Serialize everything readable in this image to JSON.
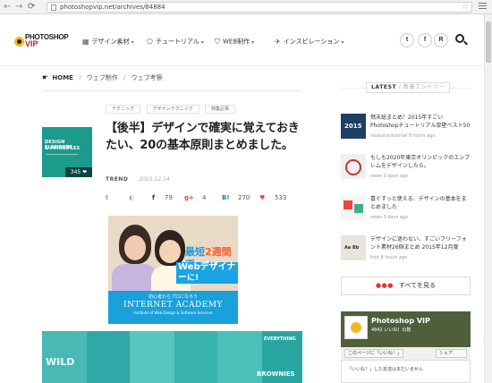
{
  "browser": {
    "back": "←",
    "forward": "→",
    "reload": "⟳",
    "url": "photoshopvip.net/archives/84884",
    "star": "☆"
  },
  "header": {
    "logo_line1": "PHOTOSHOP",
    "logo_line2": "VIP",
    "nav": [
      {
        "label": "デザイン素材",
        "icon": "grid-icon"
      },
      {
        "label": "チュートリアル",
        "icon": "pentagon-icon"
      },
      {
        "label": "WEB制作",
        "icon": "html5-icon"
      },
      {
        "label": "インスピレーション",
        "icon": "rocket-icon"
      }
    ],
    "social": {
      "twitter": "t",
      "facebook": "f",
      "rss": "R",
      "feedly": "◐"
    }
  },
  "breadcrumb": {
    "hand": "☛",
    "home": "HOME",
    "items": [
      "ウェブ制作",
      "ウェブ考察"
    ],
    "separator": "/"
  },
  "article": {
    "tags": [
      "テクニック",
      "デザインテクニック",
      "特集記事"
    ],
    "title": "【後半】デザインで確実に覚えておきたい、20の基本原則まとめました。",
    "thumb_line1": "DESIGN ELEMENTS",
    "thumb_line2": "& PRINCIPLES",
    "thumb_count": "345 ❤",
    "category": "TREND",
    "date": "2015.12.14",
    "share": {
      "twitter_count": "",
      "hatena_count": "",
      "facebook_count": "79",
      "gplus_count": "4",
      "hatena_b_count": "270",
      "pocket_count": "533"
    }
  },
  "ad": {
    "headline_prefix": "最短",
    "headline_highlight": "2週間",
    "headline_suffix": "で",
    "subline": "Webデザイナー",
    "subline_suffix": "に!",
    "line1": "初心者からプロになろう",
    "brand": "INTERNET ACADEMY",
    "brand_sub": "Institute of Web Design & Software Services"
  },
  "banner": {
    "t1": "WILD",
    "t2": "EVERYTHING",
    "t3": "BROWNIES"
  },
  "sidebar": {
    "label_en": "LATEST",
    "label_ja": "/ 新着エントリー",
    "items": [
      {
        "title": "燃末総まとめ！2015年すごいPhotoshopチュートリアル厚壁ベスト50",
        "source": "resource.tutorial 8 hours ago",
        "thumb_text": "2015"
      },
      {
        "title": "もしも2020年東京オリンピックのエンブレムをデザインしたら。",
        "source": "news 3 days ago",
        "thumb_text": ""
      },
      {
        "title": "喜ぐすっと使える、デザインの基本をまとめました",
        "source": "news 3 days ago",
        "thumb_text": ""
      },
      {
        "title": "デザインに迷わない、すごいフリーフォント素材26個まとめ 2015年12月度",
        "source": "font 8 hours ago",
        "thumb_text": ""
      }
    ],
    "more_dots": "●●●",
    "more_label": "すべてを見る",
    "fb": {
      "name": "Photoshop VIP",
      "likes": "4842 いいね！の数",
      "like_button": "このページに「いいね！」",
      "share_button": "シェア",
      "footer": "「いいね！」した友達はまだいません"
    }
  },
  "colors": {
    "brand_red": "#b8241b",
    "ad_blue": "#1aa0db",
    "teal": "#3fc3bd"
  }
}
